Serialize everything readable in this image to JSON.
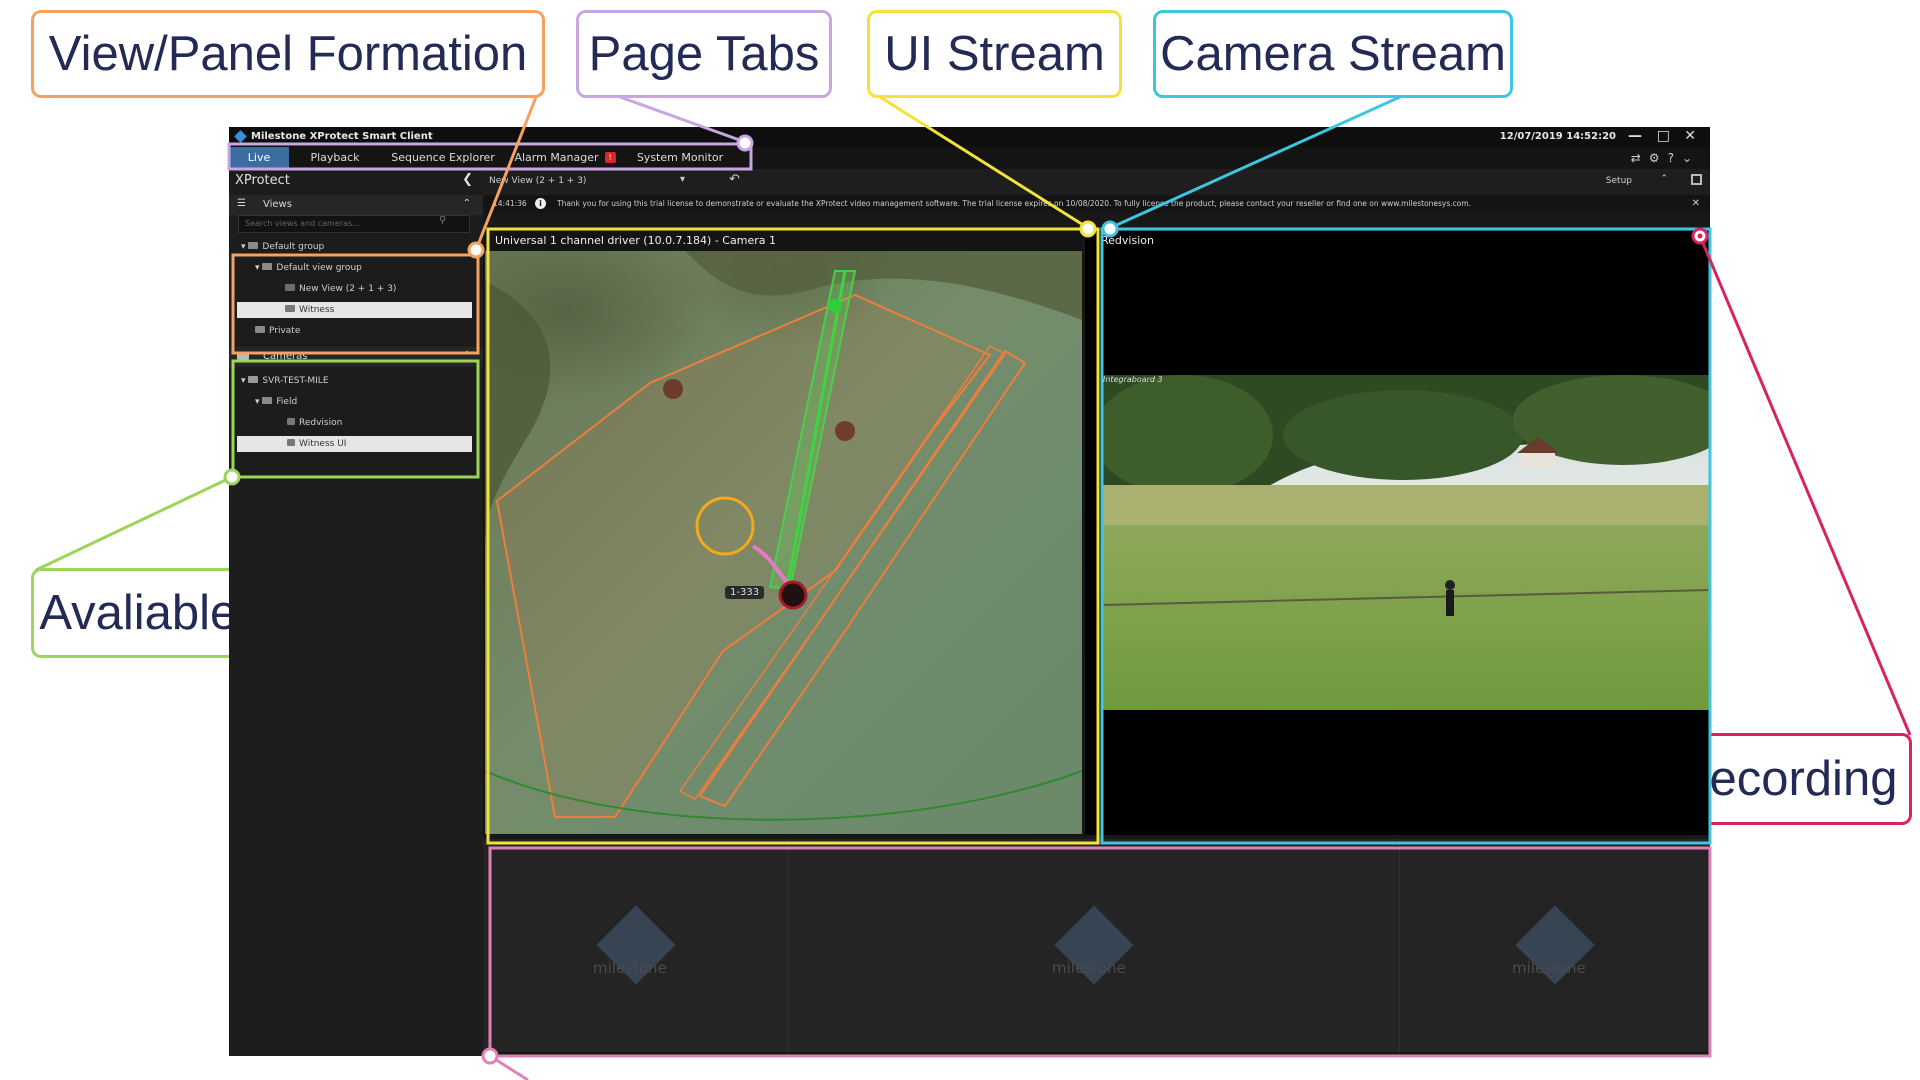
{
  "callouts": {
    "view_panel_formation": "View/Panel Formation",
    "page_tabs": "Page Tabs",
    "ui_stream": "UI Stream",
    "camera_stream": "Camera Stream",
    "available_cameras": "Avaliable Cameras",
    "stream_recording": "Stream Recording"
  },
  "window": {
    "title": "Milestone XProtect Smart Client",
    "datetime": "12/07/2019 14:52:20"
  },
  "tabs": [
    {
      "label": "Live"
    },
    {
      "label": "Playback"
    },
    {
      "label": "Sequence Explorer"
    },
    {
      "label": "Alarm Manager",
      "badge": "!"
    },
    {
      "label": "System Monitor"
    }
  ],
  "sidebar": {
    "title": "XProtect",
    "views_label": "Views",
    "search_placeholder": "Search views and cameras...",
    "view_tree": [
      {
        "label": "Default group"
      },
      {
        "label": "Default view group"
      },
      {
        "label": "New View (2 + 1 + 3)"
      },
      {
        "label": "Witness"
      },
      {
        "label": "Private"
      }
    ],
    "cameras_label": "Cameras",
    "camera_tree": [
      {
        "label": "SVR-TEST-MILE"
      },
      {
        "label": "Field"
      },
      {
        "label": "Redvision"
      },
      {
        "label": "Witness UI"
      }
    ]
  },
  "toolbar": {
    "view_selector": "New View (2 + 1 + 3)",
    "setup_label": "Setup"
  },
  "info": {
    "time": "14:41:36",
    "message": "Thank you for using this trial license to demonstrate or evaluate the XProtect video management software. The trial license expires on 10/08/2020. To fully license the product, please contact your reseller or find one on www.milestonesys.com."
  },
  "panes": {
    "map_title": "Universal 1 channel driver (10.0.7.184) - Camera 1",
    "camera_title": "Redvision",
    "camera_overlay": "Integraboard 3",
    "map_marker_label": "1-333"
  },
  "bottom_placeholder": "milestone",
  "colors": {
    "view_panel": "#f4a261",
    "page_tabs": "#c9a6e0",
    "ui_stream": "#f2e23a",
    "camera_stream": "#3ec6e0",
    "available_cameras": "#9dd45a",
    "stream_recording": "#d8245e",
    "bottom_panel": "#e080b8",
    "active_tab": "#3b6da3"
  }
}
